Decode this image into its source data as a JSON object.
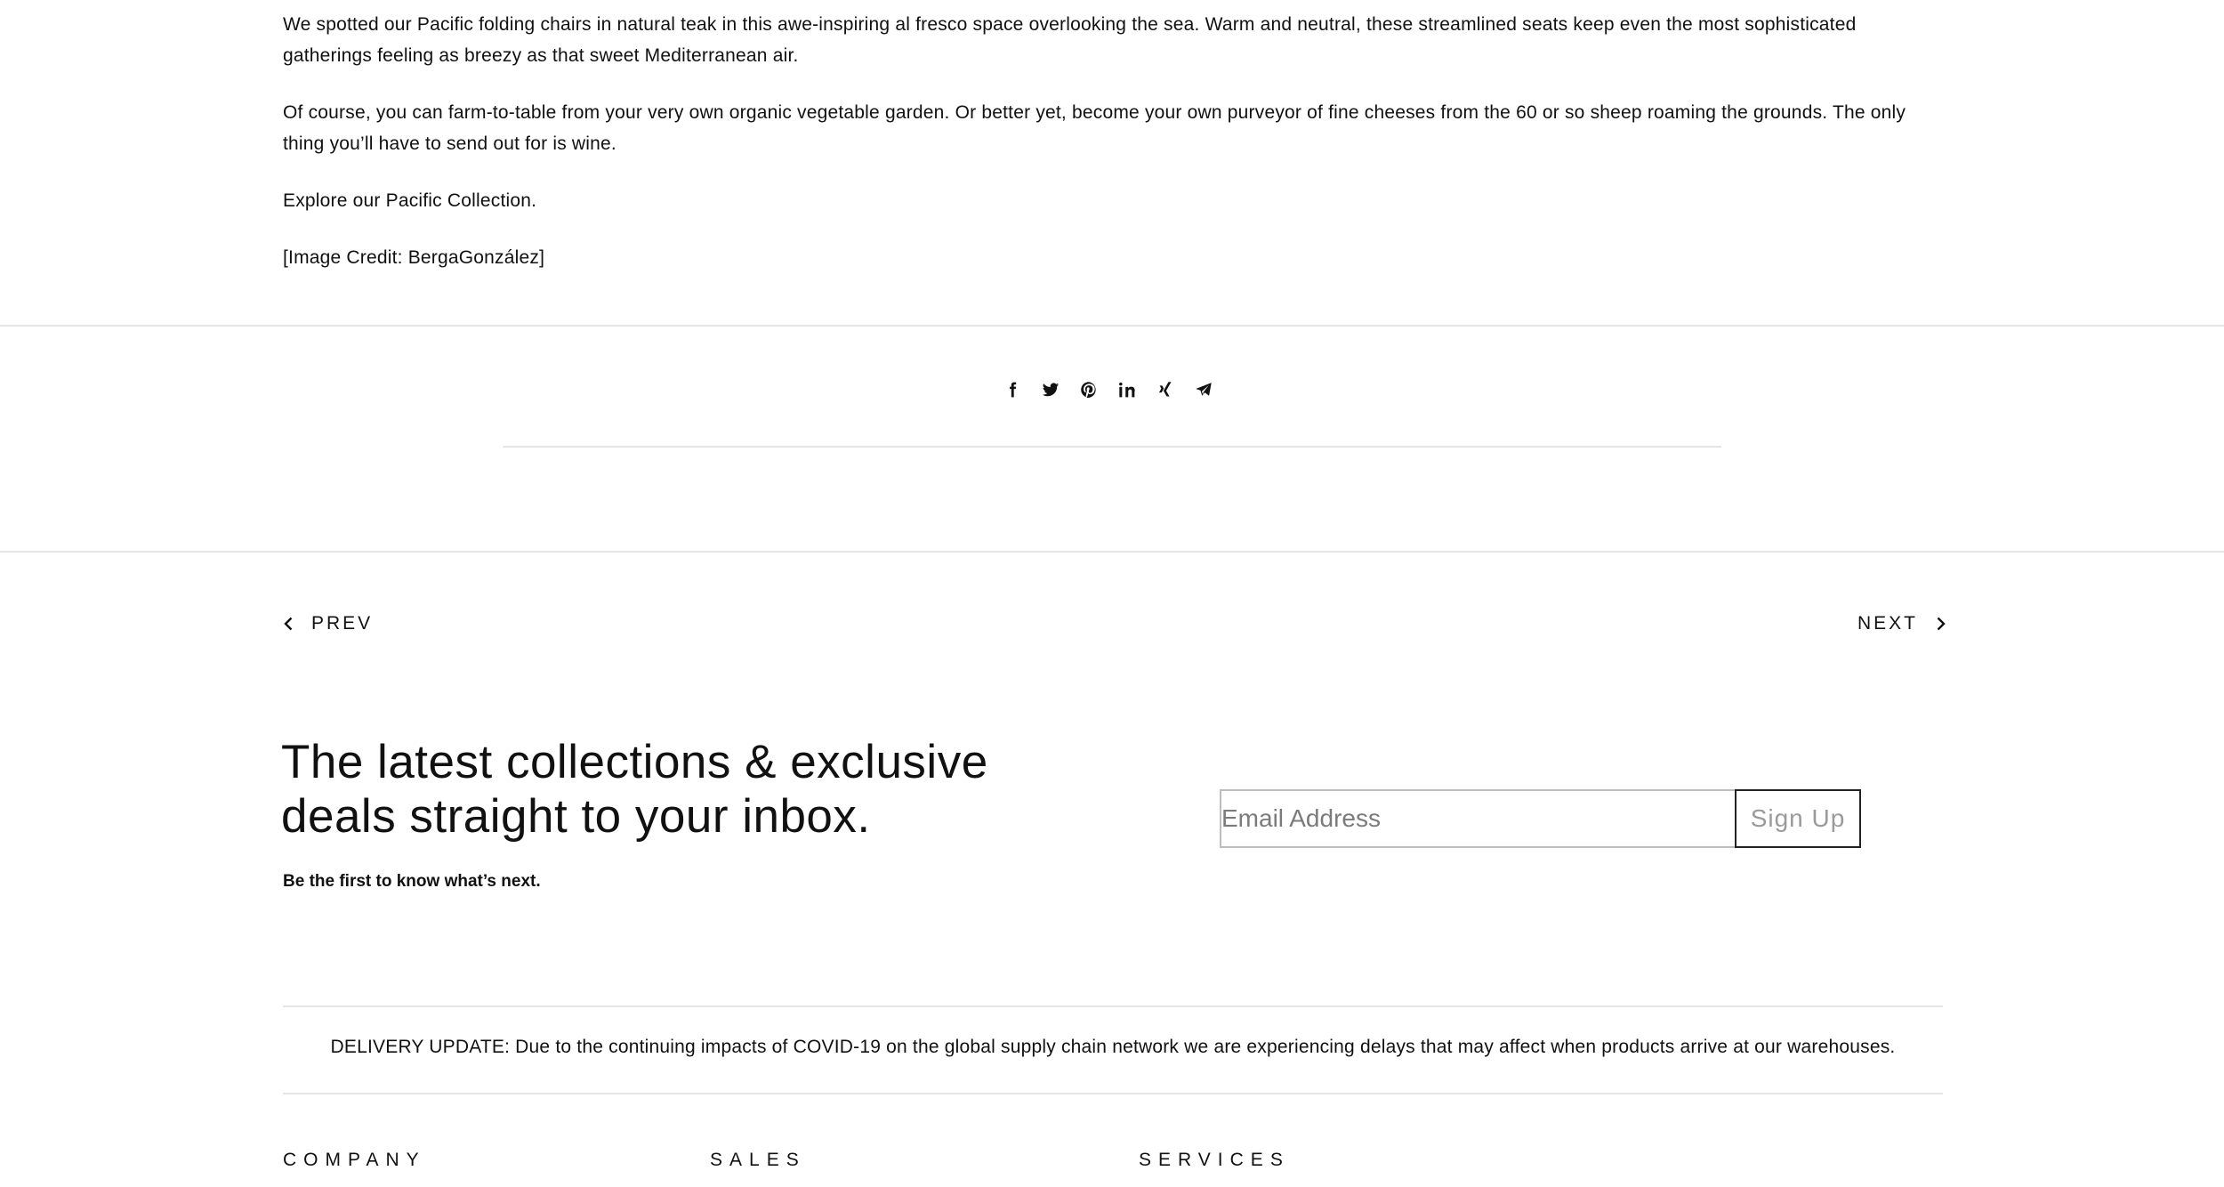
{
  "article": {
    "paragraphs": [
      "We spotted our Pacific folding chairs in natural teak in this awe-inspiring al fresco space overlooking the sea. Warm and neutral, these streamlined seats keep even the most sophisticated gatherings feeling as breezy as that sweet Mediterranean air.",
      "Of course, you can farm-to-table from your very own organic vegetable garden. Or better yet, become your own purveyor of fine cheeses from the 60 or so sheep roaming the grounds. The only thing you’ll have to send out for is wine.",
      "Explore our Pacific Collection.",
      "[Image Credit: BergaGonzález]"
    ]
  },
  "share": {
    "icons": [
      "facebook-icon",
      "twitter-icon",
      "pinterest-icon",
      "linkedin-icon",
      "xing-icon",
      "telegram-icon"
    ]
  },
  "pagination": {
    "prev_label": "PREV",
    "next_label": "NEXT"
  },
  "newsletter": {
    "title": "The latest collections & exclusive deals straight to your inbox.",
    "subtitle": "Be the first to know what’s next.",
    "email_placeholder": "Email Address",
    "signup_label": "Sign Up"
  },
  "delivery_notice": "DELIVERY UPDATE: Due to the continuing impacts of COVID-19 on the global supply chain network we are experiencing delays that may affect when products arrive at our warehouses.",
  "footer": {
    "columns": [
      "COMPANY",
      "SALES",
      "SERVICES"
    ]
  }
}
